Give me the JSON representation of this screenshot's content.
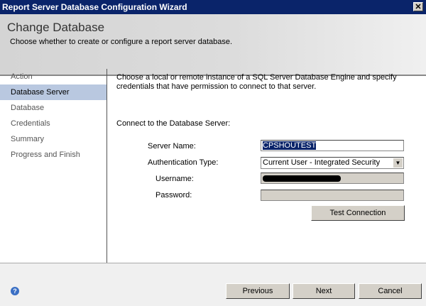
{
  "window": {
    "title": "Report Server Database Configuration Wizard",
    "close": "✕"
  },
  "header": {
    "title": "Change Database",
    "subtitle": "Choose whether to create or configure a report server database."
  },
  "sidebar": {
    "items": [
      {
        "label": "Action"
      },
      {
        "label": "Database Server"
      },
      {
        "label": "Database"
      },
      {
        "label": "Credentials"
      },
      {
        "label": "Summary"
      },
      {
        "label": "Progress and Finish"
      }
    ]
  },
  "main": {
    "intro": "Choose a local or remote instance of a SQL Server Database Engine and specify credentials that have permission to connect to that server.",
    "connect_label": "Connect to the Database Server:",
    "server_name_label": "Server Name:",
    "server_name": "CPSHOUTEST",
    "auth_label": "Authentication Type:",
    "auth_value": "Current User - Integrated Security",
    "username_label": "Username:",
    "password_label": "Password:",
    "test_connection": "Test Connection"
  },
  "footer": {
    "help": "?",
    "previous": "Previous",
    "next": "Next",
    "cancel": "Cancel"
  }
}
